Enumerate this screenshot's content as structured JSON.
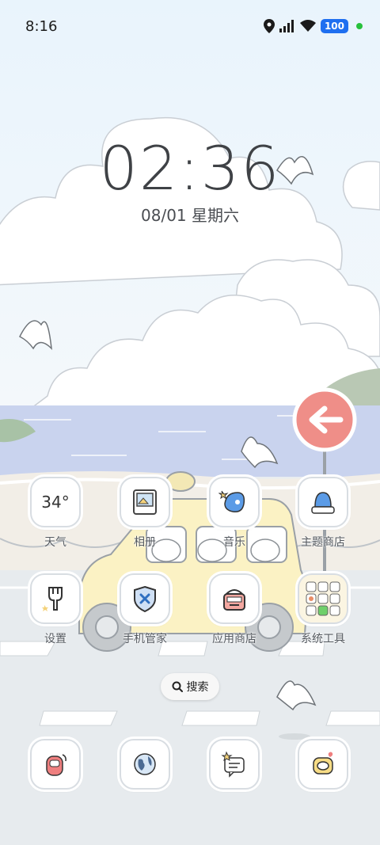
{
  "status_bar": {
    "time": "8:16",
    "battery": "100",
    "icons": [
      "location-icon",
      "signal-icon",
      "wifi-icon",
      "battery-icon",
      "green-dot-icon"
    ]
  },
  "lockscreen": {
    "clock": "02:36",
    "date": "08/01 星期六"
  },
  "apps_row1": [
    {
      "label": "天气",
      "icon": "weather-icon",
      "value": "34°"
    },
    {
      "label": "相册",
      "icon": "gallery-icon"
    },
    {
      "label": "音乐",
      "icon": "music-icon"
    },
    {
      "label": "主题商店",
      "icon": "theme-store-icon"
    }
  ],
  "apps_row2": [
    {
      "label": "设置",
      "icon": "settings-icon"
    },
    {
      "label": "手机管家",
      "icon": "phone-manager-icon"
    },
    {
      "label": "应用商店",
      "icon": "app-store-icon"
    },
    {
      "label": "系统工具",
      "icon": "system-tools-folder-icon"
    }
  ],
  "search": {
    "label": "搜索"
  },
  "dock": [
    {
      "icon": "phone-icon"
    },
    {
      "icon": "browser-icon"
    },
    {
      "icon": "messages-icon"
    },
    {
      "icon": "camera-icon"
    }
  ],
  "colors": {
    "sky": "#e8f3fc",
    "sea": "#c9d3ee",
    "accent_blue": "#1f6ff0",
    "sign_red": "#ef8e88",
    "car_yellow": "#fbf2c4"
  }
}
